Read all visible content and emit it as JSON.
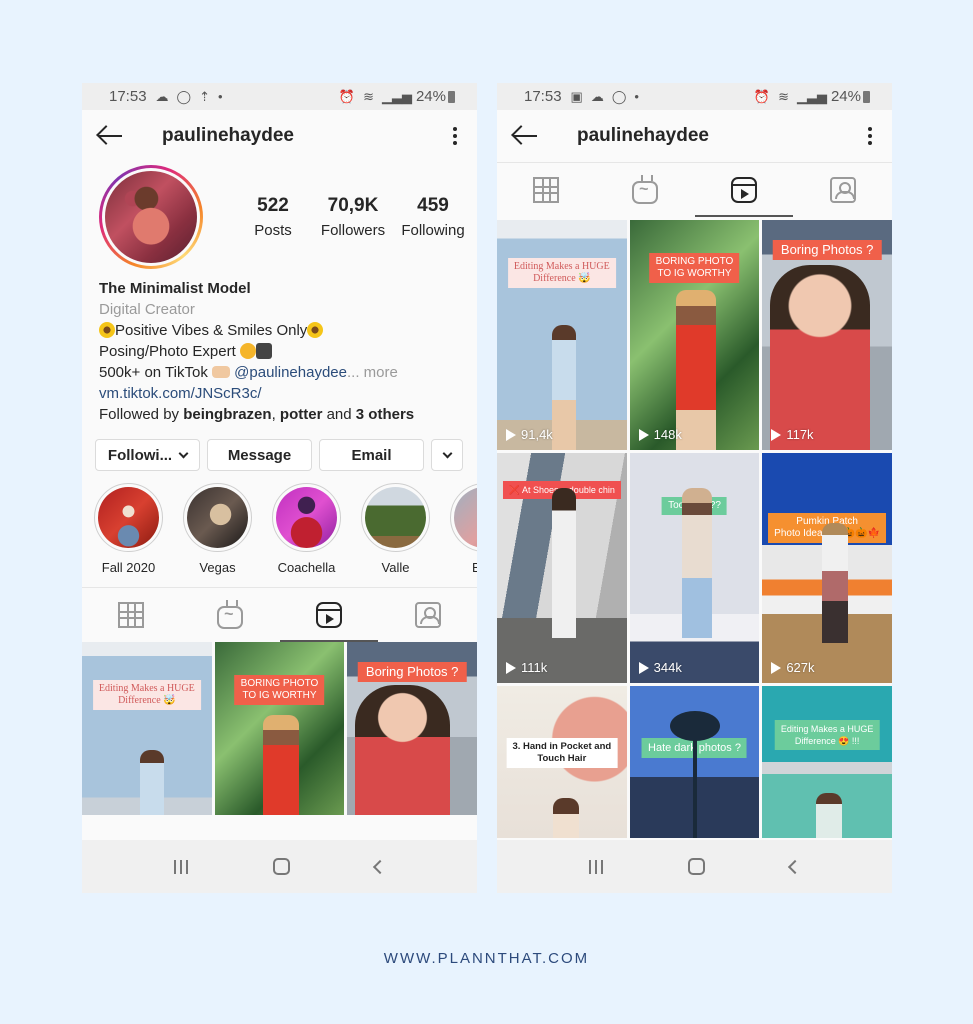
{
  "phones": {
    "left": {
      "status": {
        "time": "17:53",
        "battery": "24%"
      },
      "header": {
        "username": "paulinehaydee"
      },
      "stats": [
        {
          "value": "522",
          "label": "Posts"
        },
        {
          "value": "70,9K",
          "label": "Followers"
        },
        {
          "value": "459",
          "label": "Following"
        }
      ],
      "bio": {
        "name": "The Minimalist Model",
        "category": "Digital Creator",
        "line1": "Positive Vibes & Smiles Only",
        "line2": "Posing/Photo Expert ",
        "line3_prefix": "500k+ on TikTok ",
        "line3_mention": "@paulinehaydee",
        "line3_more": "... more",
        "link": "vm.tiktok.com/JNScR3c/",
        "followed_by_prefix": "Followed by ",
        "followed_by_user1": "beingbrazen",
        "followed_by_sep": ", ",
        "followed_by_user2": "potter",
        "followed_by_and": " and ",
        "followed_by_others": "3 others"
      },
      "actions": {
        "following": "Followi...",
        "message": "Message",
        "email": "Email"
      },
      "highlights": [
        {
          "label": "Fall 2020"
        },
        {
          "label": "Vegas"
        },
        {
          "label": "Coachella"
        },
        {
          "label": "Valle"
        },
        {
          "label": "Bi"
        }
      ],
      "tabs": [
        {
          "icon": "grid-icon"
        },
        {
          "icon": "igtv-icon"
        },
        {
          "icon": "reels-icon",
          "active": true
        },
        {
          "icon": "tagged-icon"
        }
      ],
      "grid": [
        {
          "caption": "Editing Makes a HUGE\nDifference 🤯"
        },
        {
          "caption": "BORING PHOTO\nTO IG WORTHY"
        },
        {
          "caption": "Boring Photos ?"
        }
      ]
    },
    "right": {
      "status": {
        "time": "17:53",
        "battery": "24%"
      },
      "header": {
        "username": "paulinehaydee"
      },
      "tabs": [
        {
          "icon": "grid-icon"
        },
        {
          "icon": "igtv-icon"
        },
        {
          "icon": "reels-icon",
          "active": true
        },
        {
          "icon": "tagged-icon"
        }
      ],
      "grid": [
        {
          "caption": "Editing Makes a HUGE\nDifference 🤯",
          "views": "91,4k"
        },
        {
          "caption": "BORING PHOTO\nTO IG WORTHY",
          "views": "148k"
        },
        {
          "caption": "Boring Photos ?",
          "views": "117k"
        },
        {
          "caption": "❌ At Shoes = double chin",
          "views": "111k"
        },
        {
          "caption": "Too Shy???",
          "views": "344k"
        },
        {
          "caption": "Pumkin Patch\nPhoto Ideas 🎃🎃🎃🍁",
          "views": "627k"
        },
        {
          "caption": "3. Hand in Pocket and\nTouch Hair",
          "views": ""
        },
        {
          "caption": "Hate dark photos ?",
          "views": ""
        },
        {
          "caption": "Editing Makes a HUGE\nDifference 😍 !!!",
          "views": ""
        }
      ]
    }
  },
  "footer": {
    "url": "WWW.PLANNTHAT.COM"
  }
}
